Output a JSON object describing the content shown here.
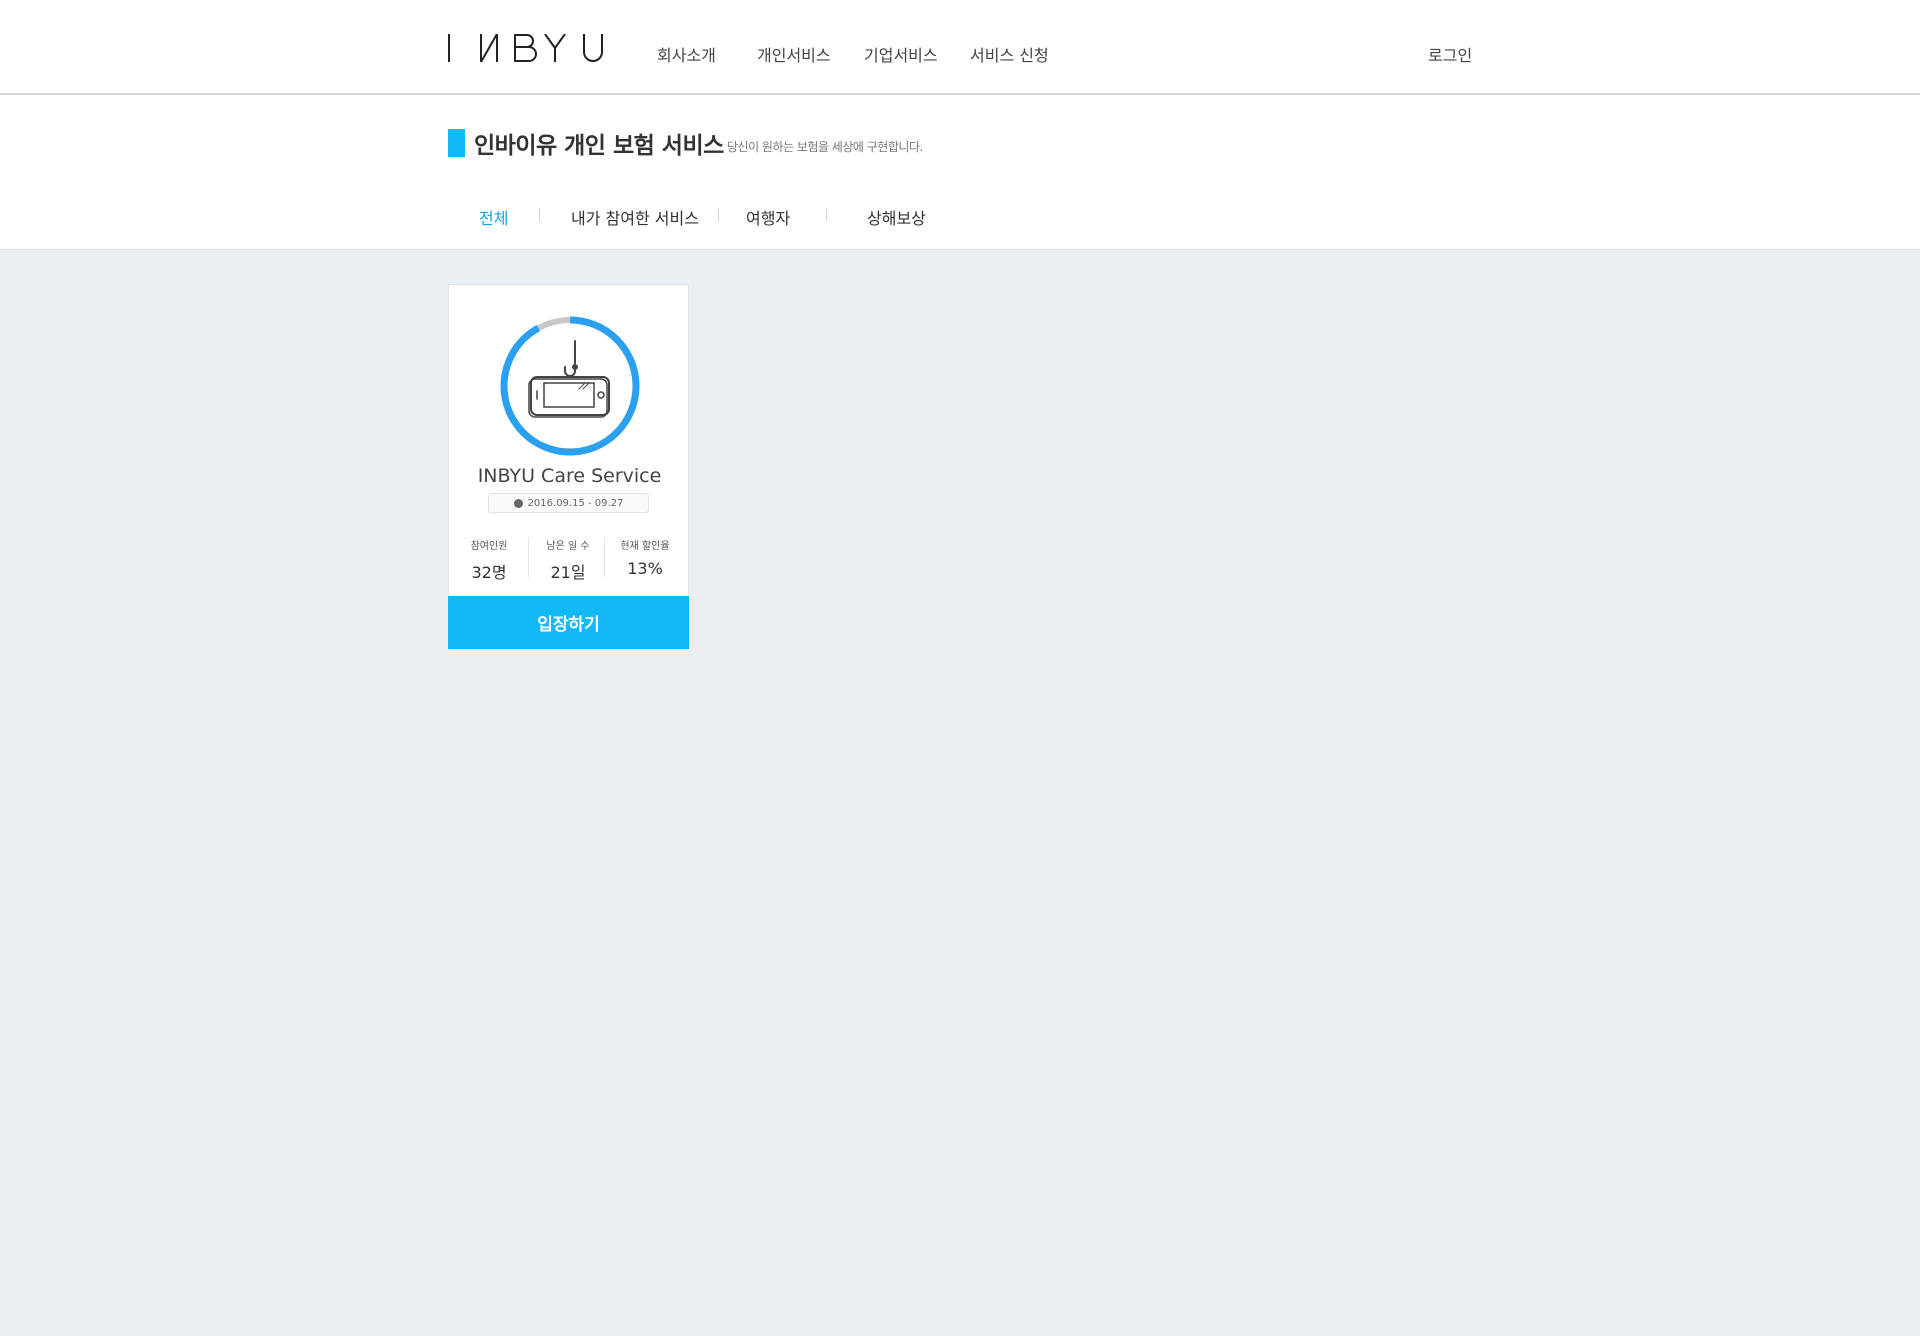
{
  "header": {
    "logo_text": "INBYU",
    "nav": [
      {
        "label": "회사소개"
      },
      {
        "label": "개인서비스"
      },
      {
        "label": "기업서비스"
      },
      {
        "label": "서비스 신청"
      }
    ],
    "login_label": "로그인"
  },
  "page": {
    "title": "인바이유 개인 보험 서비스",
    "subtitle": "당신이 원하는 보험을 세상에 구현합니다.",
    "tabs": [
      {
        "label": "전체",
        "active": true
      },
      {
        "label": "내가 참여한 서비스",
        "active": false
      },
      {
        "label": "여행자",
        "active": false
      },
      {
        "label": "상해보상",
        "active": false
      }
    ]
  },
  "cards": [
    {
      "name": "INBYU Care Service",
      "date_range": "2016.09.15 - 09.27",
      "progress": 0.92,
      "stats": [
        {
          "label": "참여인원",
          "value": "32명"
        },
        {
          "label": "남은 일 수",
          "value": "21일"
        },
        {
          "label": "현재 할인율",
          "value": "13%"
        }
      ],
      "button_label": "입장하기",
      "icon": "phone-hook-icon"
    }
  ],
  "colors": {
    "accent": "#13b9f7",
    "ring_progress": "#2b9ff0",
    "ring_track": "#c8c8c8",
    "background": "#eaeff4"
  }
}
